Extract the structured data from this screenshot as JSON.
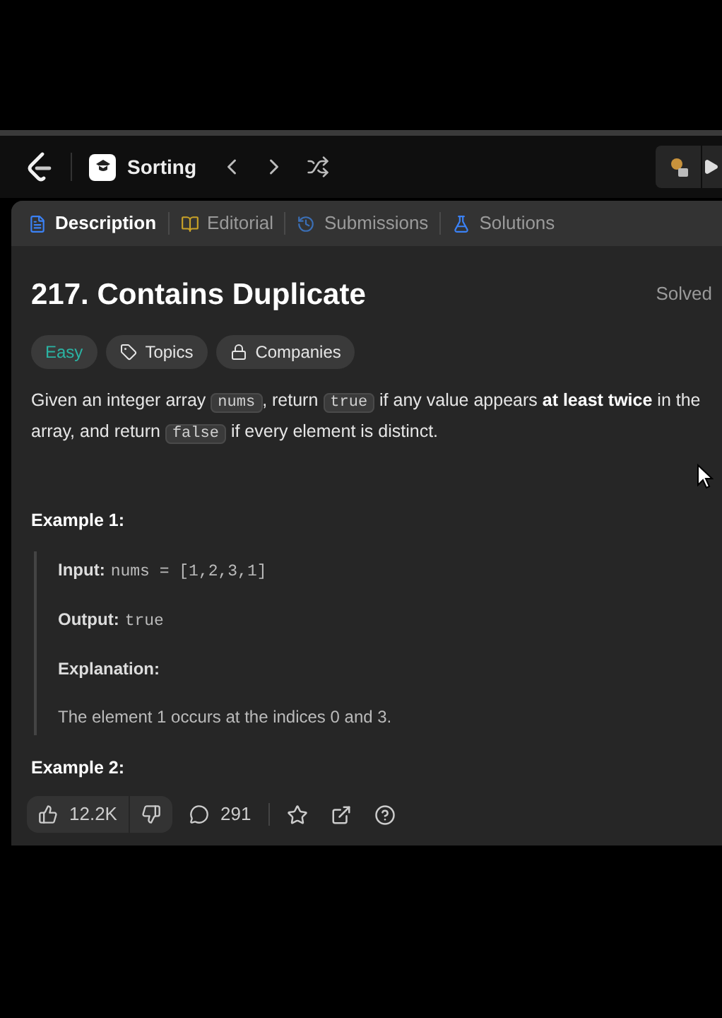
{
  "nav": {
    "list_title": "Sorting"
  },
  "tabs": [
    {
      "label": "Description",
      "kind": "description",
      "selected": true
    },
    {
      "label": "Editorial",
      "kind": "editorial",
      "selected": false
    },
    {
      "label": "Submissions",
      "kind": "submissions",
      "selected": false
    },
    {
      "label": "Solutions",
      "kind": "solutions",
      "selected": false
    }
  ],
  "problem": {
    "title": "217. Contains Duplicate",
    "status": "Solved",
    "tags": [
      {
        "label": "Easy",
        "kind": "difficulty"
      },
      {
        "label": "Topics",
        "kind": "topics"
      },
      {
        "label": "Companies",
        "kind": "companies"
      }
    ],
    "description": [
      {
        "kind": "text",
        "text": "Given an integer array "
      },
      {
        "kind": "code",
        "text": "nums"
      },
      {
        "kind": "text",
        "text": ", return "
      },
      {
        "kind": "code",
        "text": "true"
      },
      {
        "kind": "text",
        "text": " if any value appears "
      },
      {
        "kind": "bold",
        "text": "at least twice"
      },
      {
        "kind": "text",
        "text": " in the array, and return "
      },
      {
        "kind": "code",
        "text": "false"
      },
      {
        "kind": "text",
        "text": " if every element is distinct."
      }
    ],
    "examples": [
      {
        "heading": "Example 1:",
        "input_label": "Input:",
        "input": "nums = [1,2,3,1]",
        "output_label": "Output:",
        "output": "true",
        "explanation_label": "Explanation:",
        "explanation": "The element 1 occurs at the indices 0 and 3."
      }
    ],
    "next_heading": "Example 2:"
  },
  "footer": {
    "likes": "12.2K",
    "comments": "291"
  }
}
